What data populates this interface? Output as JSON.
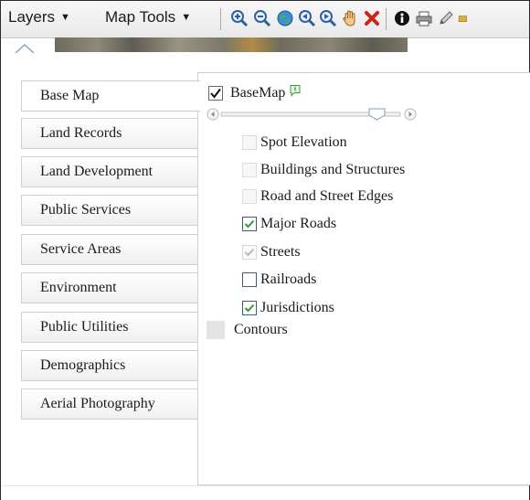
{
  "toolbar": {
    "layers_label": "Layers",
    "map_tools_label": "Map Tools",
    "tools": [
      "zoom-in-icon",
      "zoom-out-icon",
      "globe-icon",
      "zoom-previous-icon",
      "zoom-next-icon",
      "pan-hand-icon",
      "clear-icon",
      "identify-icon",
      "print-icon",
      "draw-pencil-icon"
    ]
  },
  "tabs": [
    {
      "label": "Base Map",
      "active": true
    },
    {
      "label": "Land Records"
    },
    {
      "label": "Land Development"
    },
    {
      "label": "Public Services"
    },
    {
      "label": "Service Areas"
    },
    {
      "label": "Environment"
    },
    {
      "label": "Public Utilities"
    },
    {
      "label": "Demographics"
    },
    {
      "label": "Aerial Photography"
    }
  ],
  "panel": {
    "basemap_label": "BaseMap",
    "basemap_checked": true,
    "layers": [
      {
        "label": "Spot Elevation",
        "state": "unchecked-disabled"
      },
      {
        "label": "Buildings and Structures",
        "state": "unchecked-disabled"
      },
      {
        "label": "Road and Street Edges",
        "state": "unchecked-disabled"
      },
      {
        "label": "Major Roads",
        "state": "checked"
      },
      {
        "label": "Streets",
        "state": "checked-disabled"
      },
      {
        "label": "Railroads",
        "state": "unchecked"
      },
      {
        "label": "Jurisdictions",
        "state": "checked"
      }
    ],
    "contours_label": "Contours",
    "opacity_level": 0.9
  },
  "colors": {
    "check_green": "#2e9b2e",
    "accent_blue": "#3b5b86",
    "info_green": "#5cb85c"
  }
}
